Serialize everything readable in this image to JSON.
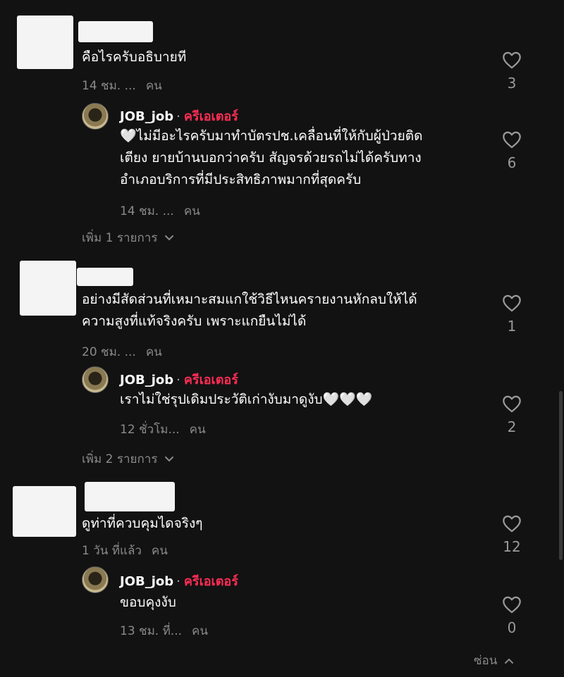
{
  "comments": [
    {
      "text": "คือไรครับอธิบายที",
      "time": "14 ชม. ...",
      "label": "คน",
      "likes": "3",
      "reply": {
        "name": "JOB_job",
        "separator": "·",
        "badge": "ครีเอเตอร์",
        "lines": [
          "🤍ไม่มีอะไรครับมาทำบัตรปช.เคลื่อนที่ให้กับผู้ป่วยติด",
          "เตียง ยายบ้านบอกว่าครับ สัญจรด้วยรถไม่ได้ครับทาง",
          "อำเภอบริการที่มีประสิทธิภาพมากที่สุดครับ"
        ],
        "time": "14 ชม. ...",
        "label": "คน",
        "likes": "6"
      },
      "more": "เพิ่ม 1 รายการ"
    },
    {
      "lines": [
        "อย่างมีสัดส่วนที่เหมาะสมแกใช้วิธีไหนครายงานหักลบให้ได้",
        "ความสูงที่แท้จริงครับ เพราะแกยืนไม่ได้"
      ],
      "time": "20 ชม. ...",
      "label": "คน",
      "likes": "1",
      "reply": {
        "name": "JOB_job",
        "separator": "·",
        "badge": "ครีเอเตอร์",
        "text": "เราไม่ใช่รุปเดิมประวัติเก่างับมาดูงับ🤍🤍🤍",
        "time": "12 ชั่วโม...",
        "label": "คน",
        "likes": "2"
      },
      "more": "เพิ่ม 2 รายการ"
    },
    {
      "text": "ดูท่าที่ควบคุมไดจริงๆ",
      "time": "1 วัน ที่แล้ว",
      "label": "คน",
      "likes": "12",
      "reply": {
        "name": "JOB_job",
        "separator": "·",
        "badge": "ครีเอเตอร์",
        "text": "ขอบคุงงับ",
        "time": "13 ชม. ที่...",
        "label": "คน",
        "likes": "0"
      }
    }
  ],
  "hide_label": "ซ่อน",
  "colors": {
    "background": "#121212",
    "creator": "#fe2c55",
    "muted": "#8a8a8a"
  },
  "icons": {
    "like": "heart-outline-icon",
    "expand": "chevron-down-icon",
    "collapse": "chevron-up-icon"
  }
}
